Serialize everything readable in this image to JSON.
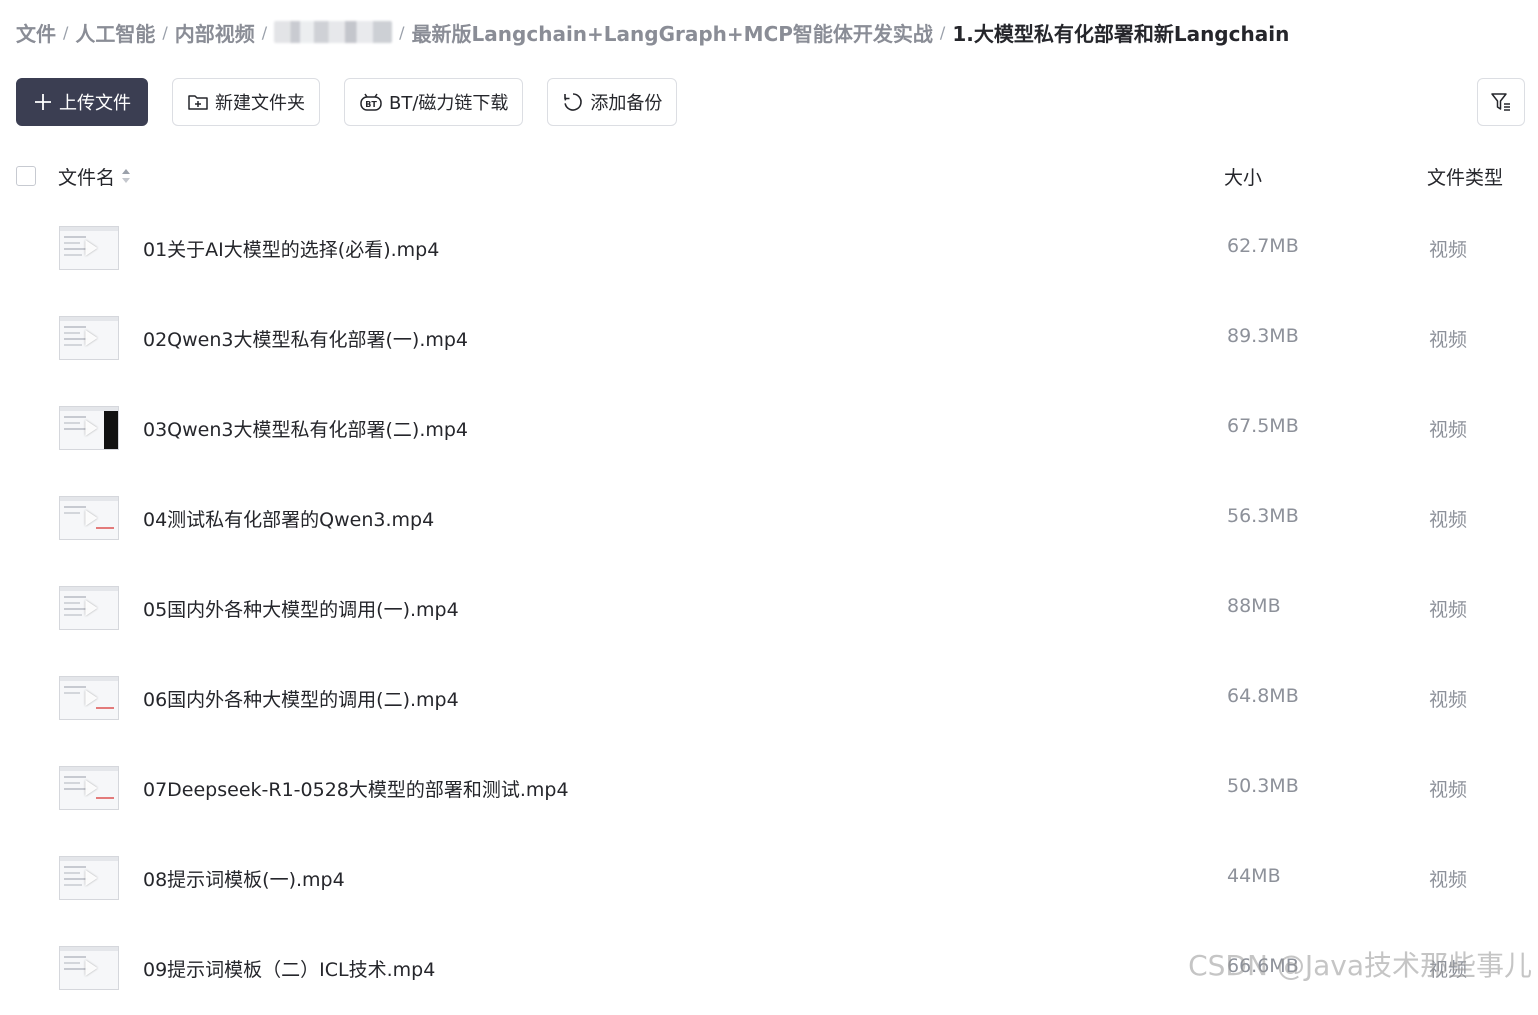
{
  "breadcrumb": {
    "items": [
      "文件",
      "人工智能",
      "内部视频",
      "最新版Langchain+LangGraph+MCP智能体开发实战"
    ],
    "current": "1.大模型私有化部署和新Langchain",
    "separator": "/"
  },
  "toolbar": {
    "upload_label": "上传文件",
    "new_folder_label": "新建文件夹",
    "bt_label": "BT/磁力链下载",
    "backup_label": "添加备份"
  },
  "table": {
    "headers": {
      "name": "文件名",
      "size": "大小",
      "type": "文件类型"
    },
    "rows": [
      {
        "name": "01关于AI大模型的选择(必看).mp4",
        "size": "62.7MB",
        "type": "视频"
      },
      {
        "name": "02Qwen3大模型私有化部署(一).mp4",
        "size": "89.3MB",
        "type": "视频"
      },
      {
        "name": "03Qwen3大模型私有化部署(二).mp4",
        "size": "67.5MB",
        "type": "视频"
      },
      {
        "name": "04测试私有化部署的Qwen3.mp4",
        "size": "56.3MB",
        "type": "视频"
      },
      {
        "name": "05国内外各种大模型的调用(一).mp4",
        "size": "88MB",
        "type": "视频"
      },
      {
        "name": "06国内外各种大模型的调用(二).mp4",
        "size": "64.8MB",
        "type": "视频"
      },
      {
        "name": "07Deepseek-R1-0528大模型的部署和测试.mp4",
        "size": "50.3MB",
        "type": "视频"
      },
      {
        "name": "08提示词模板(一).mp4",
        "size": "44MB",
        "type": "视频"
      },
      {
        "name": "09提示词模板（二）ICL技术.mp4",
        "size": "66.6MB",
        "type": "视频"
      }
    ]
  },
  "watermark": "CSDN @Java技术那些事儿",
  "colors": {
    "primary_button": "#3b3e52",
    "muted_text": "#8d919a",
    "text": "#25262b"
  }
}
